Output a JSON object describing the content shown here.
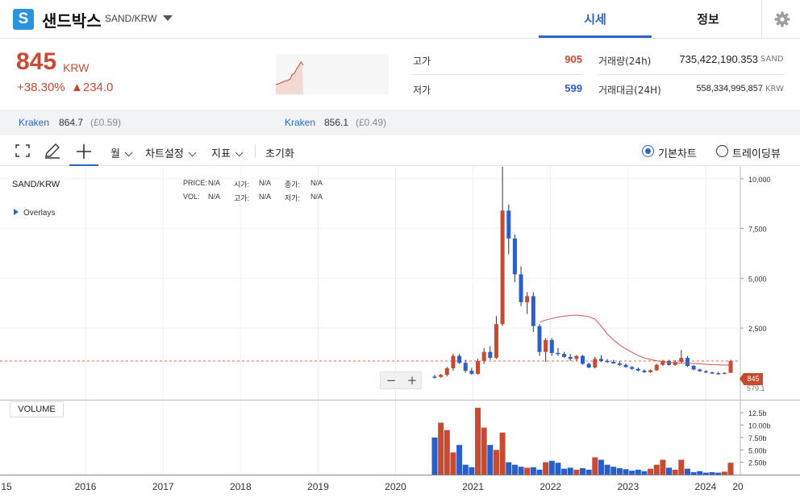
{
  "header": {
    "logo_letter": "S",
    "coin_name": "샌드박스",
    "pair": "SAND/KRW",
    "tabs": [
      {
        "label": "시세",
        "active": true
      },
      {
        "label": "정보",
        "active": false
      }
    ]
  },
  "price": {
    "current": "845",
    "unit": "KRW",
    "change_pct": "+38.30%",
    "change_amt": "▲234.0"
  },
  "stats": {
    "high_label": "고가",
    "high_value": "905",
    "low_label": "저가",
    "low_value": "599",
    "volume_label": "거래량(24h)",
    "volume_value": "735,422,190.353",
    "volume_unit": "SAND",
    "amount_label": "거래대금(24H)",
    "amount_value": "558,334,995,857",
    "amount_unit": "KRW"
  },
  "exchanges": [
    {
      "name": "Kraken",
      "price": "864.7",
      "diff": "(£0.59)"
    },
    {
      "name": "Kraken",
      "price": "856.1",
      "diff": "(£0.49)"
    }
  ],
  "toolbar": {
    "period": "월",
    "chart_settings": "차트설정",
    "indicators": "지표",
    "reset": "초기화",
    "basic_chart": "기본차트",
    "tradingview": "트레이딩뷰"
  },
  "chart_legend": {
    "pair": "SAND/KRW",
    "price_label": "PRICE:",
    "price_value": "N/A",
    "open_label": "시가:",
    "open_value": "N/A",
    "close_label": "종가:",
    "close_value": "N/A",
    "vol_label": "VOL:",
    "vol_value": "N/A",
    "high_label": "고가:",
    "high_value": "N/A",
    "low_label": "저가:",
    "low_value": "N/A",
    "overlays": "Overlays",
    "volume_button": "VOLUME",
    "zoom_out": "−",
    "zoom_in": "+",
    "last_price_tag": "845",
    "hidden_value": "579.1"
  },
  "colors": {
    "up": "#c84a31",
    "down": "#2a5fc9",
    "accent": "#2a67c9",
    "ma": "#d9534f"
  },
  "chart_data": {
    "type": "candlestick",
    "title": "SAND/KRW",
    "x_ticks": [
      "15",
      "2016",
      "2017",
      "2018",
      "2019",
      "2020",
      "2021",
      "2022",
      "2023",
      "2024",
      "20"
    ],
    "y_ticks": [
      "10,000",
      "7,500",
      "5,000",
      "2,500"
    ],
    "y_range": [
      -1100,
      10600
    ],
    "volume_ticks": [
      "12.5b",
      "10.00b",
      "7.50b",
      "5.00b",
      "2.50b"
    ],
    "volume_range": [
      0,
      14
    ],
    "candles": [
      {
        "open": 60,
        "high": 150,
        "low": -30,
        "close": 40
      },
      {
        "open": 40,
        "high": 200,
        "low": 0,
        "close": 150
      },
      {
        "open": 150,
        "high": 550,
        "low": 80,
        "close": 480
      },
      {
        "open": 480,
        "high": 1200,
        "low": 350,
        "close": 1100
      },
      {
        "open": 1100,
        "high": 1200,
        "low": 700,
        "close": 750
      },
      {
        "open": 750,
        "high": 900,
        "low": 250,
        "close": 350
      },
      {
        "open": 350,
        "high": 500,
        "low": 150,
        "close": 200
      },
      {
        "open": 200,
        "high": 950,
        "low": 150,
        "close": 850
      },
      {
        "open": 850,
        "high": 1500,
        "low": 700,
        "close": 1300
      },
      {
        "open": 1300,
        "high": 1600,
        "low": 900,
        "close": 1000
      },
      {
        "open": 1000,
        "high": 3100,
        "low": 950,
        "close": 2700
      },
      {
        "open": 2700,
        "high": 10600,
        "low": 2600,
        "close": 8400
      },
      {
        "open": 8400,
        "high": 8700,
        "low": 6200,
        "close": 7000
      },
      {
        "open": 7000,
        "high": 7200,
        "low": 4800,
        "close": 5200
      },
      {
        "open": 5200,
        "high": 5600,
        "low": 3600,
        "close": 3800
      },
      {
        "open": 3800,
        "high": 4300,
        "low": 3200,
        "close": 4100
      },
      {
        "open": 4100,
        "high": 4300,
        "low": 2300,
        "close": 2600
      },
      {
        "open": 2600,
        "high": 2700,
        "low": 1100,
        "close": 1300
      },
      {
        "open": 1300,
        "high": 2000,
        "low": 800,
        "close": 1900
      },
      {
        "open": 1900,
        "high": 2000,
        "low": 1100,
        "close": 1250
      },
      {
        "open": 1250,
        "high": 1500,
        "low": 1100,
        "close": 1200
      },
      {
        "open": 1200,
        "high": 1300,
        "low": 1000,
        "close": 1050
      },
      {
        "open": 1050,
        "high": 1200,
        "low": 850,
        "close": 950
      },
      {
        "open": 950,
        "high": 1150,
        "low": 850,
        "close": 1100
      },
      {
        "open": 1100,
        "high": 1150,
        "low": 650,
        "close": 700
      },
      {
        "open": 700,
        "high": 750,
        "low": 480,
        "close": 520
      },
      {
        "open": 520,
        "high": 1050,
        "low": 480,
        "close": 950
      },
      {
        "open": 950,
        "high": 1150,
        "low": 800,
        "close": 850
      },
      {
        "open": 850,
        "high": 950,
        "low": 750,
        "close": 800
      },
      {
        "open": 800,
        "high": 900,
        "low": 700,
        "close": 720
      },
      {
        "open": 720,
        "high": 820,
        "low": 600,
        "close": 650
      },
      {
        "open": 650,
        "high": 720,
        "low": 500,
        "close": 540
      },
      {
        "open": 540,
        "high": 600,
        "low": 400,
        "close": 450
      },
      {
        "open": 450,
        "high": 520,
        "low": 330,
        "close": 360
      },
      {
        "open": 360,
        "high": 420,
        "low": 250,
        "close": 280
      },
      {
        "open": 280,
        "high": 420,
        "low": 250,
        "close": 380
      },
      {
        "open": 380,
        "high": 700,
        "low": 350,
        "close": 650
      },
      {
        "open": 650,
        "high": 900,
        "low": 600,
        "close": 850
      },
      {
        "open": 850,
        "high": 900,
        "low": 620,
        "close": 650
      },
      {
        "open": 650,
        "high": 880,
        "low": 600,
        "close": 800
      },
      {
        "open": 800,
        "high": 1400,
        "low": 750,
        "close": 1000
      },
      {
        "open": 1000,
        "high": 1100,
        "low": 550,
        "close": 600
      },
      {
        "open": 600,
        "high": 650,
        "low": 380,
        "close": 420
      },
      {
        "open": 420,
        "high": 460,
        "low": 300,
        "close": 330
      },
      {
        "open": 330,
        "high": 380,
        "low": 240,
        "close": 270
      },
      {
        "open": 270,
        "high": 310,
        "low": 200,
        "close": 230
      },
      {
        "open": 230,
        "high": 300,
        "low": 180,
        "close": 210
      },
      {
        "open": 210,
        "high": 280,
        "low": 190,
        "close": 250
      },
      {
        "open": 250,
        "high": 905,
        "low": 240,
        "close": 845
      }
    ],
    "volume": [
      7.5,
      10.5,
      9.0,
      4.5,
      6.0,
      2.0,
      1.5,
      13.5,
      9.5,
      6.0,
      5.0,
      8.5,
      2.5,
      2.0,
      1.6,
      1.4,
      1.5,
      1.0,
      2.5,
      2.8,
      2.4,
      1.2,
      1.4,
      1.0,
      1.3,
      1.0,
      3.5,
      3.0,
      2.0,
      1.6,
      1.3,
      1.1,
      0.8,
      1.0,
      0.7,
      1.2,
      2.0,
      3.0,
      1.4,
      1.0,
      3.0,
      1.2,
      0.5,
      0.7,
      0.4,
      0.5,
      0.4,
      0.6,
      2.4
    ],
    "ma": [
      null,
      null,
      null,
      null,
      null,
      null,
      null,
      null,
      null,
      null,
      null,
      null,
      null,
      null,
      null,
      null,
      null,
      2800,
      2900,
      2980,
      3050,
      3100,
      3130,
      3150,
      3120,
      3080,
      2950,
      2600,
      2200,
      1900,
      1650,
      1450,
      1280,
      1120,
      1000,
      920,
      860,
      810,
      780,
      760,
      740,
      730,
      720,
      700,
      680,
      660,
      650,
      640,
      630
    ]
  }
}
